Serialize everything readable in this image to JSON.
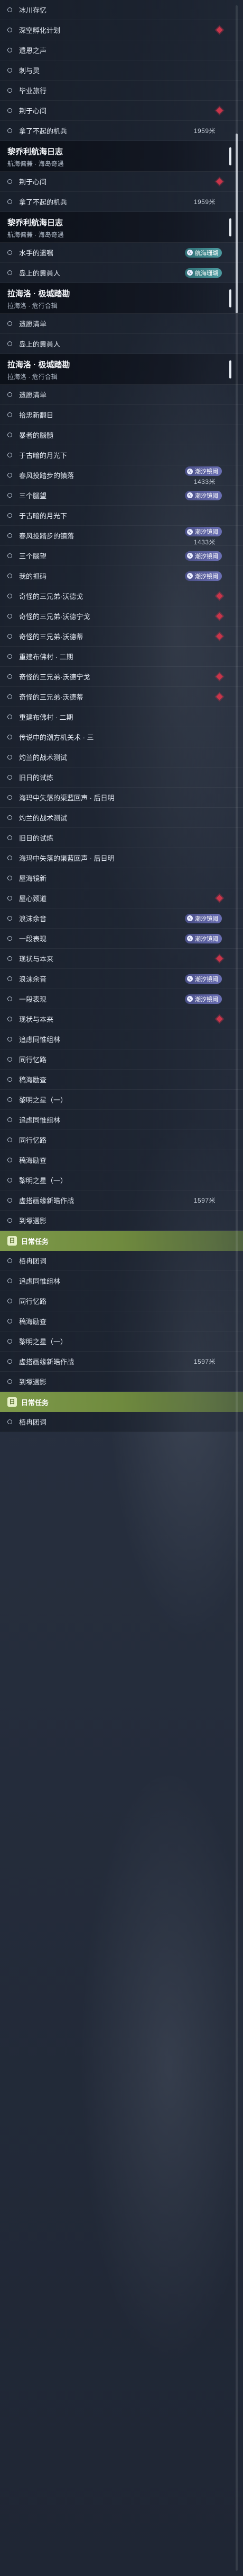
{
  "blocks": [
    {
      "rows": [
        {
          "label": "冰川存忆"
        },
        {
          "label": "深空孵化计划",
          "diamond": true
        },
        {
          "label": "遗恩之声"
        },
        {
          "label": "刺与灵"
        },
        {
          "label": "毕业旅行"
        },
        {
          "label": "荆于心间",
          "diamond": true
        },
        {
          "label": "拿了不起的机兵",
          "dist": "1959米"
        }
      ]
    },
    {
      "header": {
        "title": "黎乔利航海日志",
        "subtitle": "航海傭兼 · 海岛奇遇"
      }
    },
    {
      "rows": [
        {
          "label": "荆于心间",
          "diamond": true
        },
        {
          "label": "拿了不起的机兵",
          "dist": "1959米"
        }
      ]
    },
    {
      "header": {
        "title": "黎乔利航海日志",
        "subtitle": "航海傭兼 · 海岛奇遇"
      }
    },
    {
      "rows": [
        {
          "label": "水手的遗嘱",
          "badge": {
            "text": "航海珊瑚",
            "color": "teal"
          }
        },
        {
          "label": "岛上的囊員人",
          "badge": {
            "text": "航海珊瑚",
            "color": "teal"
          }
        }
      ]
    },
    {
      "header": {
        "title": "拉海洛 · 极城踏勘",
        "subtitle": "拉海洛 · 危行合辑"
      }
    },
    {
      "rows": [
        {
          "label": "遗愿清单"
        },
        {
          "label": "岛上的囊員人"
        }
      ]
    },
    {
      "header": {
        "title": "拉海洛 · 极城踏勘",
        "subtitle": "拉海洛 · 危行合辑"
      }
    },
    {
      "rows": [
        {
          "label": "遗愿清单"
        },
        {
          "label": "拾忠新翻日"
        },
        {
          "label": "暴者的腦髓"
        },
        {
          "label": "于古暗的月光下"
        },
        {
          "label": "春风投踏步的镇落",
          "badge": {
            "text": "潮汐镜阈",
            "color": "purple"
          },
          "dist": "1433米"
        },
        {
          "label": "三个腦望",
          "badge": {
            "text": "潮汐镜阈",
            "color": "purple"
          }
        },
        {
          "label": "于古暗的月光下"
        },
        {
          "label": "春风投踏步的镇落",
          "badge": {
            "text": "潮汐镜阈",
            "color": "purple"
          },
          "dist": "1433米"
        },
        {
          "label": "三个腦望",
          "badge": {
            "text": "潮汐镜阈",
            "color": "purple"
          }
        },
        {
          "label": "我的抓码",
          "badge": {
            "text": "潮汐镜阈",
            "color": "purple"
          }
        },
        {
          "label": "奇怪的三兄弟·沃德戈",
          "diamond": true
        },
        {
          "label": "奇怪的三兄弟·沃德宁戈",
          "diamond": true
        },
        {
          "label": "奇怪的三兄弟·沃德蒂",
          "diamond": true
        },
        {
          "label": "重建布佛村 · 二期"
        },
        {
          "label": "奇怪的三兄弟·沃德宁戈",
          "diamond": true
        },
        {
          "label": "奇怪的三兄弟·沃德蒂",
          "diamond": true
        },
        {
          "label": "重建布佛村 · 二期"
        },
        {
          "label": "传说中的潮方机关术 · 三"
        },
        {
          "label": "灼兰的战术测试"
        },
        {
          "label": "旧日的试炼"
        },
        {
          "label": "海玛中失落的渠蓝回声 · 后日明"
        },
        {
          "label": "灼兰的战术测试"
        },
        {
          "label": "旧日的试炼"
        },
        {
          "label": "海玛中失落的渠蓝回声 · 后日明"
        },
        {
          "label": "屋海镜新"
        },
        {
          "label": "屋心颈道",
          "diamond": true
        },
        {
          "label": "浪沫余音",
          "badge": {
            "text": "潮汐镜阈",
            "color": "purple"
          }
        },
        {
          "label": "一段表现",
          "badge": {
            "text": "潮汐镜阈",
            "color": "purple"
          }
        },
        {
          "label": "现状与本来",
          "diamond": true
        },
        {
          "label": "浪沫余音",
          "badge": {
            "text": "潮汐镜阈",
            "color": "purple"
          }
        },
        {
          "label": "一段表现",
          "badge": {
            "text": "潮汐镜阈",
            "color": "purple"
          }
        },
        {
          "label": "现状与本来",
          "diamond": true
        },
        {
          "label": "追虑同惟组林"
        },
        {
          "label": "同行忆路"
        },
        {
          "label": "稿海励查"
        },
        {
          "label": "黎明之星（一）"
        },
        {
          "label": "追虑同惟组林"
        },
        {
          "label": "同行忆路"
        },
        {
          "label": "稿海励查"
        },
        {
          "label": "黎明之星（一）"
        },
        {
          "label": "虚搭画缘新皓作战",
          "dist": "1597米"
        },
        {
          "label": "到塚選影"
        }
      ]
    },
    {
      "banner": {
        "label": "日常任务",
        "icon": "日"
      }
    },
    {
      "rows": [
        {
          "label": "栢冉团词"
        },
        {
          "label": "追虑同惟组林"
        },
        {
          "label": "同行忆路"
        },
        {
          "label": "稿海励查"
        },
        {
          "label": "黎明之星（一）"
        },
        {
          "label": "虚搭画缘新皓作战",
          "dist": "1597米"
        },
        {
          "label": "到塚選影"
        }
      ]
    },
    {
      "banner": {
        "label": "日常任务",
        "icon": "日"
      }
    },
    {
      "rows": [
        {
          "label": "栢冉团词"
        }
      ]
    }
  ],
  "scroll": {
    "position": 0.05,
    "visible_fraction": 0.07
  },
  "colors": {
    "accent_red": "#c9354a",
    "badge_purple": "#5b60a3",
    "badge_teal": "#3e858a",
    "banner_green": "#7a9646"
  },
  "icons": {
    "row": "ring-icon",
    "tracked": "diamond-marker-icon",
    "badge": "tide-icon",
    "banner": "daily-task-icon"
  }
}
